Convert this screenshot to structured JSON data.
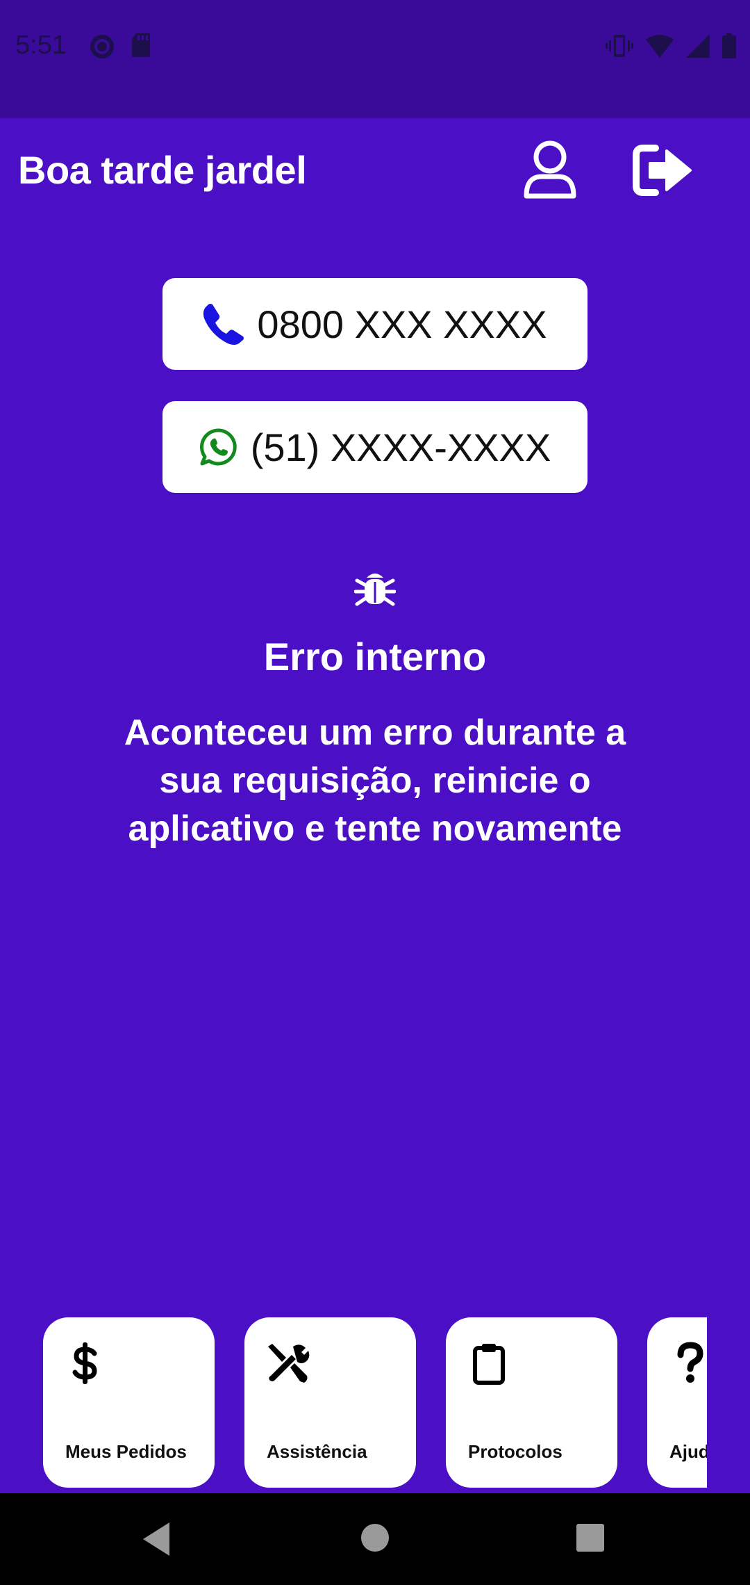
{
  "status_bar": {
    "time": "5:51",
    "left_icons": [
      "pocket-casts-icon",
      "sd-card-icon"
    ],
    "right_icons": [
      "vibrate-icon",
      "wifi-icon",
      "signal-icon",
      "battery-icon"
    ]
  },
  "header": {
    "greeting": "Boa tarde jardel",
    "profile_icon": "user-icon",
    "logout_icon": "sign-out-icon"
  },
  "contacts": {
    "phone": {
      "icon": "phone-icon",
      "number": "0800 XXX XXXX",
      "icon_color": "#1A14E0"
    },
    "whatsapp": {
      "icon": "whatsapp-icon",
      "number": "(51) XXXX-XXXX",
      "icon_color": "#138A1E"
    }
  },
  "error": {
    "icon": "bug-icon",
    "title": "Erro interno",
    "message": "Aconteceu um erro durante a sua requisição, reinicie o aplicativo e tente novamente"
  },
  "menu": {
    "items": [
      {
        "icon": "dollar-icon",
        "label": "Meus Pedidos"
      },
      {
        "icon": "tools-icon",
        "label": "Assistência"
      },
      {
        "icon": "clipboard-icon",
        "label": "Protocolos"
      },
      {
        "icon": "question-icon",
        "label": "Ajuda"
      }
    ]
  },
  "nav_bar": {
    "buttons": [
      "back-icon",
      "home-icon",
      "recents-icon"
    ]
  },
  "colors": {
    "background": "#4B0FC5",
    "status_bar": "#3A0A98",
    "card": "#FFFFFF",
    "text_light": "#FFFFFF"
  }
}
